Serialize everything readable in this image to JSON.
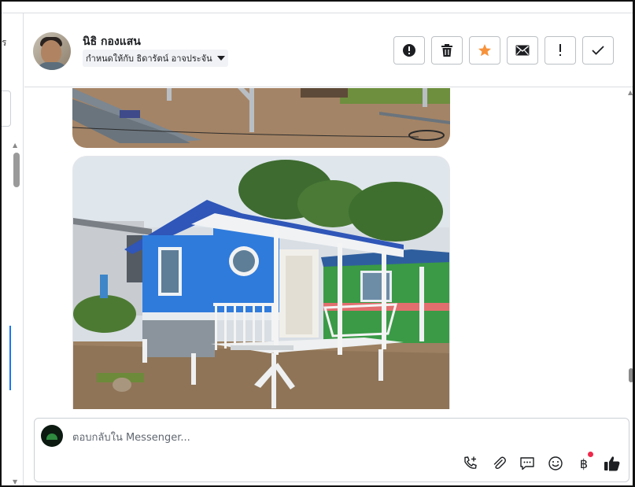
{
  "left_strip": {
    "cut_text": "ร"
  },
  "header": {
    "contact_name": "นิธิ กองแสน",
    "assign_label": "กำหนดให้กับ ธิดารัตน์ อาจประจัน",
    "actions": [
      {
        "icon": "alert-circle-icon",
        "name": "mark-spam-button"
      },
      {
        "icon": "trash-icon",
        "name": "delete-button"
      },
      {
        "icon": "star-icon",
        "name": "star-button",
        "color": "#f7923b"
      },
      {
        "icon": "envelope-icon",
        "name": "mark-unread-button"
      },
      {
        "icon": "exclamation-icon",
        "name": "follow-up-button"
      },
      {
        "icon": "checkmark-icon",
        "name": "mark-done-button"
      }
    ]
  },
  "composer": {
    "placeholder": "ตอบกลับใน Messenger...",
    "tools": [
      "phone-plus-icon",
      "paperclip-icon",
      "chat-bubble-icon",
      "smiley-icon",
      "baht-icon",
      "thumbs-up-icon"
    ],
    "baht_symbol": "฿"
  },
  "colors": {
    "accent": "#1877f2",
    "star": "#f7923b",
    "notify_dot": "#f02849"
  }
}
